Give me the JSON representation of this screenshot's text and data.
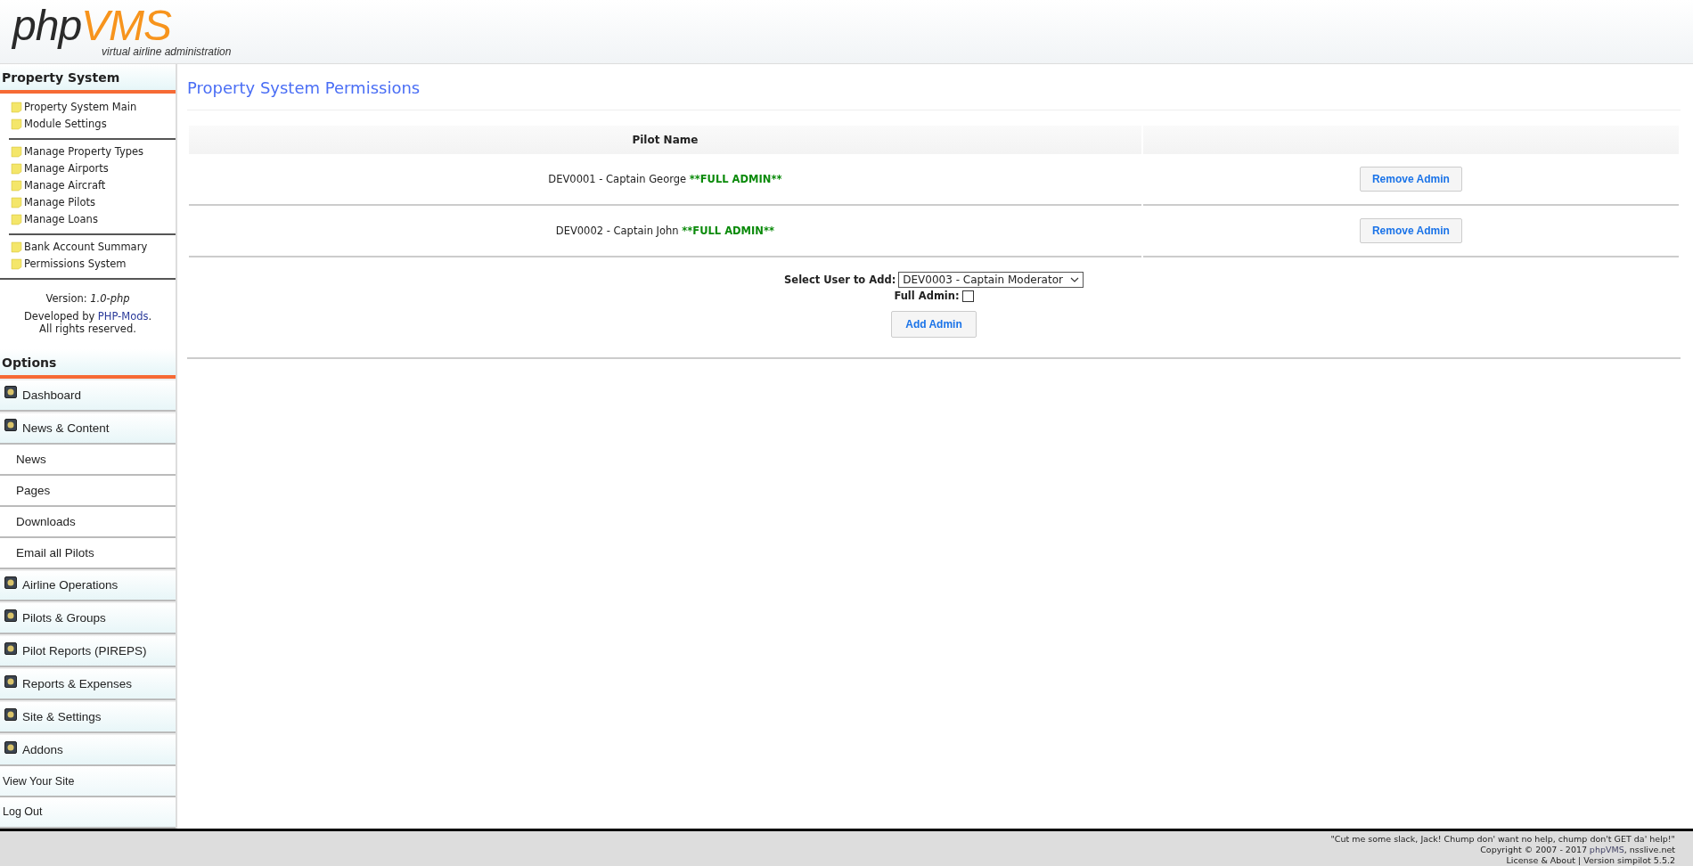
{
  "header": {
    "logo_left": "php",
    "logo_right": "VMS",
    "tagline": "virtual airline administration"
  },
  "module": {
    "title": "Property System",
    "groups": [
      [
        "Property System Main",
        "Module Settings"
      ],
      [
        "Manage Property Types",
        "Manage Airports",
        "Manage Aircraft",
        "Manage Pilots",
        "Manage Loans"
      ],
      [
        "Bank Account Summary",
        "Permissions System"
      ]
    ],
    "version": "Version: *1.0-php*",
    "developed_prefix": "Developed by",
    "developed_link": "PHP-Mods",
    "developed_suffix": ".",
    "rights": "All rights reserved."
  },
  "options": {
    "title": "Options",
    "items": [
      {
        "kind": "section",
        "label": "Dashboard"
      },
      {
        "kind": "section",
        "label": "News & Content"
      },
      {
        "kind": "sub",
        "label": "News"
      },
      {
        "kind": "sub",
        "label": "Pages"
      },
      {
        "kind": "sub",
        "label": "Downloads"
      },
      {
        "kind": "sub",
        "label": "Email all Pilots"
      },
      {
        "kind": "section",
        "label": "Airline Operations"
      },
      {
        "kind": "section",
        "label": "Pilots & Groups"
      },
      {
        "kind": "section",
        "label": "Pilot Reports (PIREPS)"
      },
      {
        "kind": "section",
        "label": "Reports & Expenses"
      },
      {
        "kind": "section",
        "label": "Site & Settings"
      },
      {
        "kind": "section",
        "label": "Addons"
      },
      {
        "kind": "plain",
        "label": "View Your Site"
      },
      {
        "kind": "plain",
        "label": "Log Out"
      }
    ]
  },
  "page_title": "Property System Permissions",
  "table": {
    "columns": [
      "Pilot Name"
    ],
    "rows": [
      {
        "pilot": "DEV0001 - Captain George",
        "role": "**FULL ADMIN**",
        "action": "Remove Admin"
      },
      {
        "pilot": "DEV0002 - Captain John",
        "role": "**FULL ADMIN**",
        "action": "Remove Admin"
      }
    ]
  },
  "add_form": {
    "select_label": "Select User to Add:",
    "select_value": "DEV0003 - Captain Moderator",
    "full_admin_label": "Full Admin:",
    "full_admin_checked": false,
    "button": "Add Admin"
  },
  "footer": {
    "quote": "\"Cut me some slack, Jack! Chump don' want no help, chump don't GET da' help!\"",
    "copyright_prefix": "Copyright © 2007 - 2017",
    "copyright_link": "phpVMS",
    "copyright_suffix": ", nsslive.net",
    "license": "License & About | Version simpilot 5.5.2"
  }
}
